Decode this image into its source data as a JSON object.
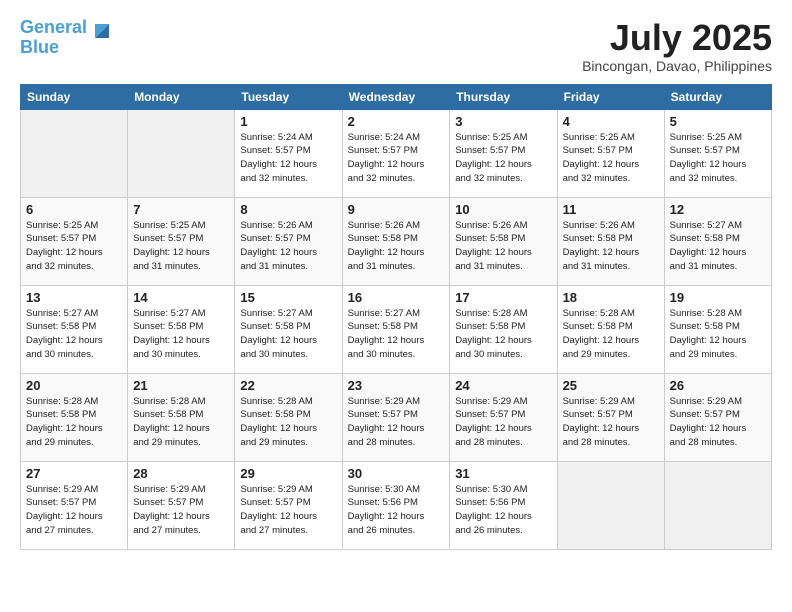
{
  "logo": {
    "line1": "General",
    "line2": "Blue"
  },
  "header": {
    "month": "July 2025",
    "location": "Bincongan, Davao, Philippines"
  },
  "weekdays": [
    "Sunday",
    "Monday",
    "Tuesday",
    "Wednesday",
    "Thursday",
    "Friday",
    "Saturday"
  ],
  "weeks": [
    [
      {
        "day": "",
        "empty": true
      },
      {
        "day": "",
        "empty": true
      },
      {
        "day": "1",
        "sunrise": "5:24 AM",
        "sunset": "5:57 PM",
        "daylight": "12 hours and 32 minutes."
      },
      {
        "day": "2",
        "sunrise": "5:24 AM",
        "sunset": "5:57 PM",
        "daylight": "12 hours and 32 minutes."
      },
      {
        "day": "3",
        "sunrise": "5:25 AM",
        "sunset": "5:57 PM",
        "daylight": "12 hours and 32 minutes."
      },
      {
        "day": "4",
        "sunrise": "5:25 AM",
        "sunset": "5:57 PM",
        "daylight": "12 hours and 32 minutes."
      },
      {
        "day": "5",
        "sunrise": "5:25 AM",
        "sunset": "5:57 PM",
        "daylight": "12 hours and 32 minutes."
      }
    ],
    [
      {
        "day": "6",
        "sunrise": "5:25 AM",
        "sunset": "5:57 PM",
        "daylight": "12 hours and 32 minutes."
      },
      {
        "day": "7",
        "sunrise": "5:25 AM",
        "sunset": "5:57 PM",
        "daylight": "12 hours and 31 minutes."
      },
      {
        "day": "8",
        "sunrise": "5:26 AM",
        "sunset": "5:57 PM",
        "daylight": "12 hours and 31 minutes."
      },
      {
        "day": "9",
        "sunrise": "5:26 AM",
        "sunset": "5:58 PM",
        "daylight": "12 hours and 31 minutes."
      },
      {
        "day": "10",
        "sunrise": "5:26 AM",
        "sunset": "5:58 PM",
        "daylight": "12 hours and 31 minutes."
      },
      {
        "day": "11",
        "sunrise": "5:26 AM",
        "sunset": "5:58 PM",
        "daylight": "12 hours and 31 minutes."
      },
      {
        "day": "12",
        "sunrise": "5:27 AM",
        "sunset": "5:58 PM",
        "daylight": "12 hours and 31 minutes."
      }
    ],
    [
      {
        "day": "13",
        "sunrise": "5:27 AM",
        "sunset": "5:58 PM",
        "daylight": "12 hours and 30 minutes."
      },
      {
        "day": "14",
        "sunrise": "5:27 AM",
        "sunset": "5:58 PM",
        "daylight": "12 hours and 30 minutes."
      },
      {
        "day": "15",
        "sunrise": "5:27 AM",
        "sunset": "5:58 PM",
        "daylight": "12 hours and 30 minutes."
      },
      {
        "day": "16",
        "sunrise": "5:27 AM",
        "sunset": "5:58 PM",
        "daylight": "12 hours and 30 minutes."
      },
      {
        "day": "17",
        "sunrise": "5:28 AM",
        "sunset": "5:58 PM",
        "daylight": "12 hours and 30 minutes."
      },
      {
        "day": "18",
        "sunrise": "5:28 AM",
        "sunset": "5:58 PM",
        "daylight": "12 hours and 29 minutes."
      },
      {
        "day": "19",
        "sunrise": "5:28 AM",
        "sunset": "5:58 PM",
        "daylight": "12 hours and 29 minutes."
      }
    ],
    [
      {
        "day": "20",
        "sunrise": "5:28 AM",
        "sunset": "5:58 PM",
        "daylight": "12 hours and 29 minutes."
      },
      {
        "day": "21",
        "sunrise": "5:28 AM",
        "sunset": "5:58 PM",
        "daylight": "12 hours and 29 minutes."
      },
      {
        "day": "22",
        "sunrise": "5:28 AM",
        "sunset": "5:58 PM",
        "daylight": "12 hours and 29 minutes."
      },
      {
        "day": "23",
        "sunrise": "5:29 AM",
        "sunset": "5:57 PM",
        "daylight": "12 hours and 28 minutes."
      },
      {
        "day": "24",
        "sunrise": "5:29 AM",
        "sunset": "5:57 PM",
        "daylight": "12 hours and 28 minutes."
      },
      {
        "day": "25",
        "sunrise": "5:29 AM",
        "sunset": "5:57 PM",
        "daylight": "12 hours and 28 minutes."
      },
      {
        "day": "26",
        "sunrise": "5:29 AM",
        "sunset": "5:57 PM",
        "daylight": "12 hours and 28 minutes."
      }
    ],
    [
      {
        "day": "27",
        "sunrise": "5:29 AM",
        "sunset": "5:57 PM",
        "daylight": "12 hours and 27 minutes."
      },
      {
        "day": "28",
        "sunrise": "5:29 AM",
        "sunset": "5:57 PM",
        "daylight": "12 hours and 27 minutes."
      },
      {
        "day": "29",
        "sunrise": "5:29 AM",
        "sunset": "5:57 PM",
        "daylight": "12 hours and 27 minutes."
      },
      {
        "day": "30",
        "sunrise": "5:30 AM",
        "sunset": "5:56 PM",
        "daylight": "12 hours and 26 minutes."
      },
      {
        "day": "31",
        "sunrise": "5:30 AM",
        "sunset": "5:56 PM",
        "daylight": "12 hours and 26 minutes."
      },
      {
        "day": "",
        "empty": true
      },
      {
        "day": "",
        "empty": true
      }
    ]
  ]
}
